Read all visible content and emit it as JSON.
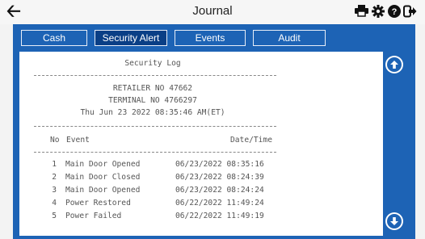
{
  "header": {
    "title": "Journal",
    "back_icon": "arrow-left-icon",
    "tools": [
      "printer-icon",
      "gear-icon",
      "help-icon",
      "logout-icon"
    ]
  },
  "tabs": [
    {
      "label": "Cash",
      "active": false
    },
    {
      "label": "Security Alert",
      "active": true
    },
    {
      "label": "Events",
      "active": false
    },
    {
      "label": "Audit",
      "active": false
    }
  ],
  "log": {
    "title": "Security Log",
    "retailer": "RETAILER NO 47662",
    "terminal": "TERMINAL NO 4766297",
    "datetime": "Thu Jun 23 2022 08:35:46 AM(ET)",
    "columns": {
      "no": "No",
      "event": "Event",
      "datetime": "Date/Time"
    },
    "rows": [
      {
        "no": "1",
        "event": "Main Door Opened",
        "datetime": "06/23/2022 08:35:16"
      },
      {
        "no": "2",
        "event": "Main Door Closed",
        "datetime": "06/23/2022 08:24:39"
      },
      {
        "no": "3",
        "event": "Main Door Opened",
        "datetime": "06/23/2022 08:24:24"
      },
      {
        "no": "4",
        "event": "Power Restored",
        "datetime": "06/22/2022 11:49:24"
      },
      {
        "no": "5",
        "event": "Power Failed",
        "datetime": "06/22/2022 11:49:19"
      }
    ]
  },
  "colors": {
    "panel": "#1d63b5",
    "active_tab": "#0a3f86"
  }
}
